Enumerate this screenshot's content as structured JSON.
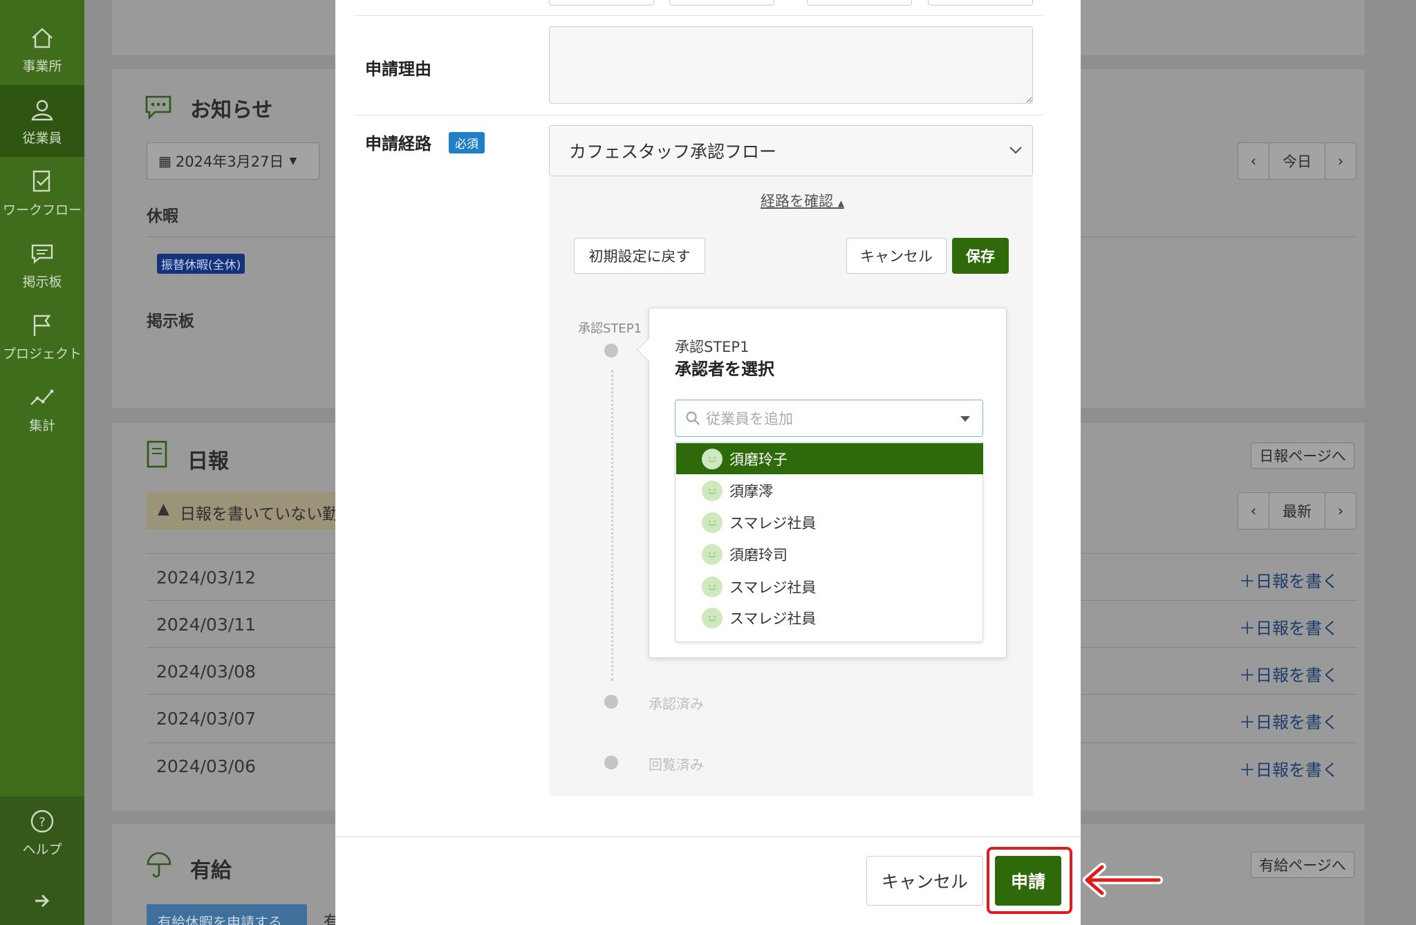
{
  "sidebar": {
    "items": [
      {
        "label": "事業所",
        "icon": "home-icon"
      },
      {
        "label": "従業員",
        "icon": "user-icon"
      },
      {
        "label": "ワークフロー",
        "icon": "workflow-icon"
      },
      {
        "label": "掲示板",
        "icon": "chat-icon"
      },
      {
        "label": "プロジェクト",
        "icon": "flag-icon"
      },
      {
        "label": "集計",
        "icon": "chart-icon"
      }
    ],
    "help_label": "ヘルプ"
  },
  "background": {
    "notice_title": "お知らせ",
    "date_selector": "2024年3月27日",
    "today_label": "今日",
    "vacation_label": "休暇",
    "vacation_badge": "振替休暇(全休)",
    "board_label": "掲示板",
    "report_title": "日報",
    "report_page_button": "日報ページへ",
    "latest_label": "最新",
    "warning_text": "日報を書いていない勤務",
    "report_dates": [
      "2024/03/12",
      "2024/03/11",
      "2024/03/08",
      "2024/03/07",
      "2024/03/06"
    ],
    "write_report_label": "日報を書く",
    "paid_title": "有給",
    "paid_page_button": "有給ページへ",
    "paid_apply_button": "有給休暇を申請する",
    "paid_extra": "有"
  },
  "modal": {
    "reason_label": "申請理由",
    "reason_value": "",
    "route_label": "申請経路",
    "required_label": "必須",
    "route_selected": "カフェスタッフ承認フロー",
    "route_check_link": "経路を確認",
    "reset_button": "初期設定に戻す",
    "cancel_button": "キャンセル",
    "save_button": "保存",
    "step1_label": "承認STEP1",
    "approved_label": "承認済み",
    "circulated_label": "回覧済み",
    "popover": {
      "step": "承認STEP1",
      "title": "承認者を選択",
      "search_placeholder": "従業員を追加",
      "options": [
        "須磨玲子",
        "須摩澪",
        "スマレジ社員",
        "須磨玲司",
        "スマレジ社員",
        "スマレジ社員"
      ]
    },
    "footer_cancel": "キャンセル",
    "footer_submit": "申請"
  },
  "colors": {
    "sidebar": "#3f6d1c",
    "primary_green": "#2f6a0a",
    "required_blue": "#1f80c8",
    "highlight_red": "#e01b1b"
  }
}
